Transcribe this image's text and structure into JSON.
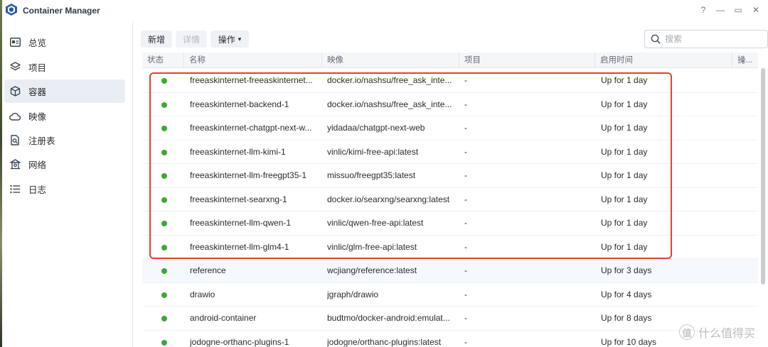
{
  "window": {
    "title": "Container Manager",
    "controls": {
      "help": "?",
      "minimize": "—",
      "maximize": "▭",
      "close": "✕"
    }
  },
  "sidebar": {
    "items": [
      {
        "label": "总览",
        "icon": "overview-icon"
      },
      {
        "label": "项目",
        "icon": "layers-icon"
      },
      {
        "label": "容器",
        "icon": "cube-icon",
        "active": true
      },
      {
        "label": "映像",
        "icon": "cloud-icon"
      },
      {
        "label": "注册表",
        "icon": "registry-icon"
      },
      {
        "label": "网络",
        "icon": "network-icon"
      },
      {
        "label": "日志",
        "icon": "list-icon"
      }
    ]
  },
  "toolbar": {
    "create_label": "新增",
    "details_label": "详情",
    "action_label": "操作",
    "action_caret": "▾",
    "search_placeholder": "搜索"
  },
  "table": {
    "columns": [
      "状态",
      "名称",
      "映像",
      "项目",
      "启用时间",
      "操..."
    ],
    "column_menu": "⋮",
    "rows": [
      {
        "status": "running",
        "name": "freeaskinternet-freeaskinternet...",
        "image": "docker.io/nashsu/free_ask_inte...",
        "project": "-",
        "uptime": "Up for 1 day"
      },
      {
        "status": "running",
        "name": "freeaskinternet-backend-1",
        "image": "docker.io/nashsu/free_ask_inte...",
        "project": "-",
        "uptime": "Up for 1 day"
      },
      {
        "status": "running",
        "name": "freeaskinternet-chatgpt-next-w...",
        "image": "yidadaa/chatgpt-next-web",
        "project": "-",
        "uptime": "Up for 1 day"
      },
      {
        "status": "running",
        "name": "freeaskinternet-llm-kimi-1",
        "image": "vinlic/kimi-free-api:latest",
        "project": "-",
        "uptime": "Up for 1 day"
      },
      {
        "status": "running",
        "name": "freeaskinternet-llm-freegpt35-1",
        "image": "missuo/freegpt35:latest",
        "project": "-",
        "uptime": "Up for 1 day"
      },
      {
        "status": "running",
        "name": "freeaskinternet-searxng-1",
        "image": "docker.io/searxng/searxng:latest",
        "project": "-",
        "uptime": "Up for 1 day"
      },
      {
        "status": "running",
        "name": "freeaskinternet-llm-qwen-1",
        "image": "vinlic/qwen-free-api:latest",
        "project": "-",
        "uptime": "Up for 1 day"
      },
      {
        "status": "running",
        "name": "freeaskinternet-llm-glm4-1",
        "image": "vinlic/glm-free-api:latest",
        "project": "-",
        "uptime": "Up for 1 day"
      },
      {
        "status": "running",
        "name": "reference",
        "image": "wcjiang/reference:latest",
        "project": "-",
        "uptime": "Up for 3 days"
      },
      {
        "status": "running",
        "name": "drawio",
        "image": "jgraph/drawio",
        "project": "-",
        "uptime": "Up for 4 days"
      },
      {
        "status": "running",
        "name": "android-container",
        "image": "budtmo/docker-android:emulat...",
        "project": "-",
        "uptime": "Up for 8 days"
      },
      {
        "status": "running",
        "name": "jodogne-orthanc-plugins-1",
        "image": "jodogne/orthanc-plugins:latest",
        "project": "-",
        "uptime": "Up for 10 days"
      }
    ]
  },
  "colors": {
    "status_running": "#3aa935",
    "highlight": "#e2412f",
    "active_nav_bg": "#e9eef5"
  },
  "watermark": {
    "logo": "值",
    "text": "什么值得买"
  }
}
